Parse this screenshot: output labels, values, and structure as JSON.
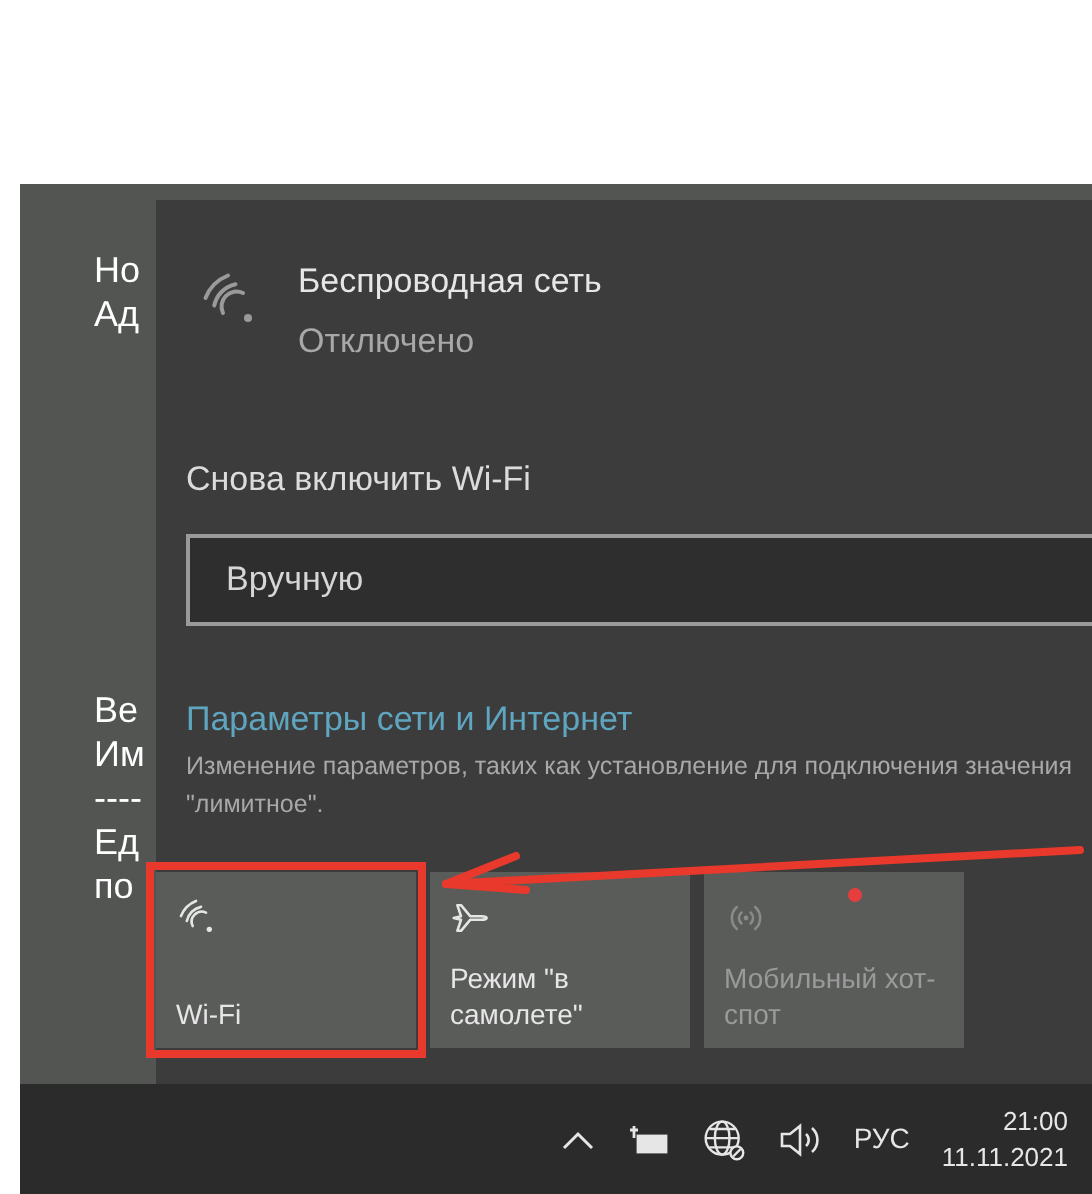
{
  "background_window": {
    "lines": [
      "Но",
      "Ад",
      "Ве",
      "Им",
      "----",
      "Ед",
      "по"
    ]
  },
  "network": {
    "name": "Беспроводная сеть",
    "status": "Отключено",
    "connected": false
  },
  "reconnect": {
    "label": "Снова включить Wi-Fi",
    "value": "Вручную"
  },
  "settings": {
    "link": "Параметры сети и Интернет",
    "description": "Изменение параметров, таких как установление для подключения значения \"лимитное\"."
  },
  "quick_actions": [
    {
      "kind": "wifi",
      "label": "Wi-Fi",
      "on": false,
      "disabled": false,
      "highlighted": true
    },
    {
      "kind": "airplane",
      "label": "Режим \"в самолете\"",
      "on": false,
      "disabled": false,
      "highlighted": false
    },
    {
      "kind": "hotspot",
      "label": "Мобильный хот-спот",
      "on": false,
      "disabled": true,
      "highlighted": false
    }
  ],
  "taskbar": {
    "language": "РУС",
    "time": "21:00",
    "date": "11.11.2021"
  }
}
